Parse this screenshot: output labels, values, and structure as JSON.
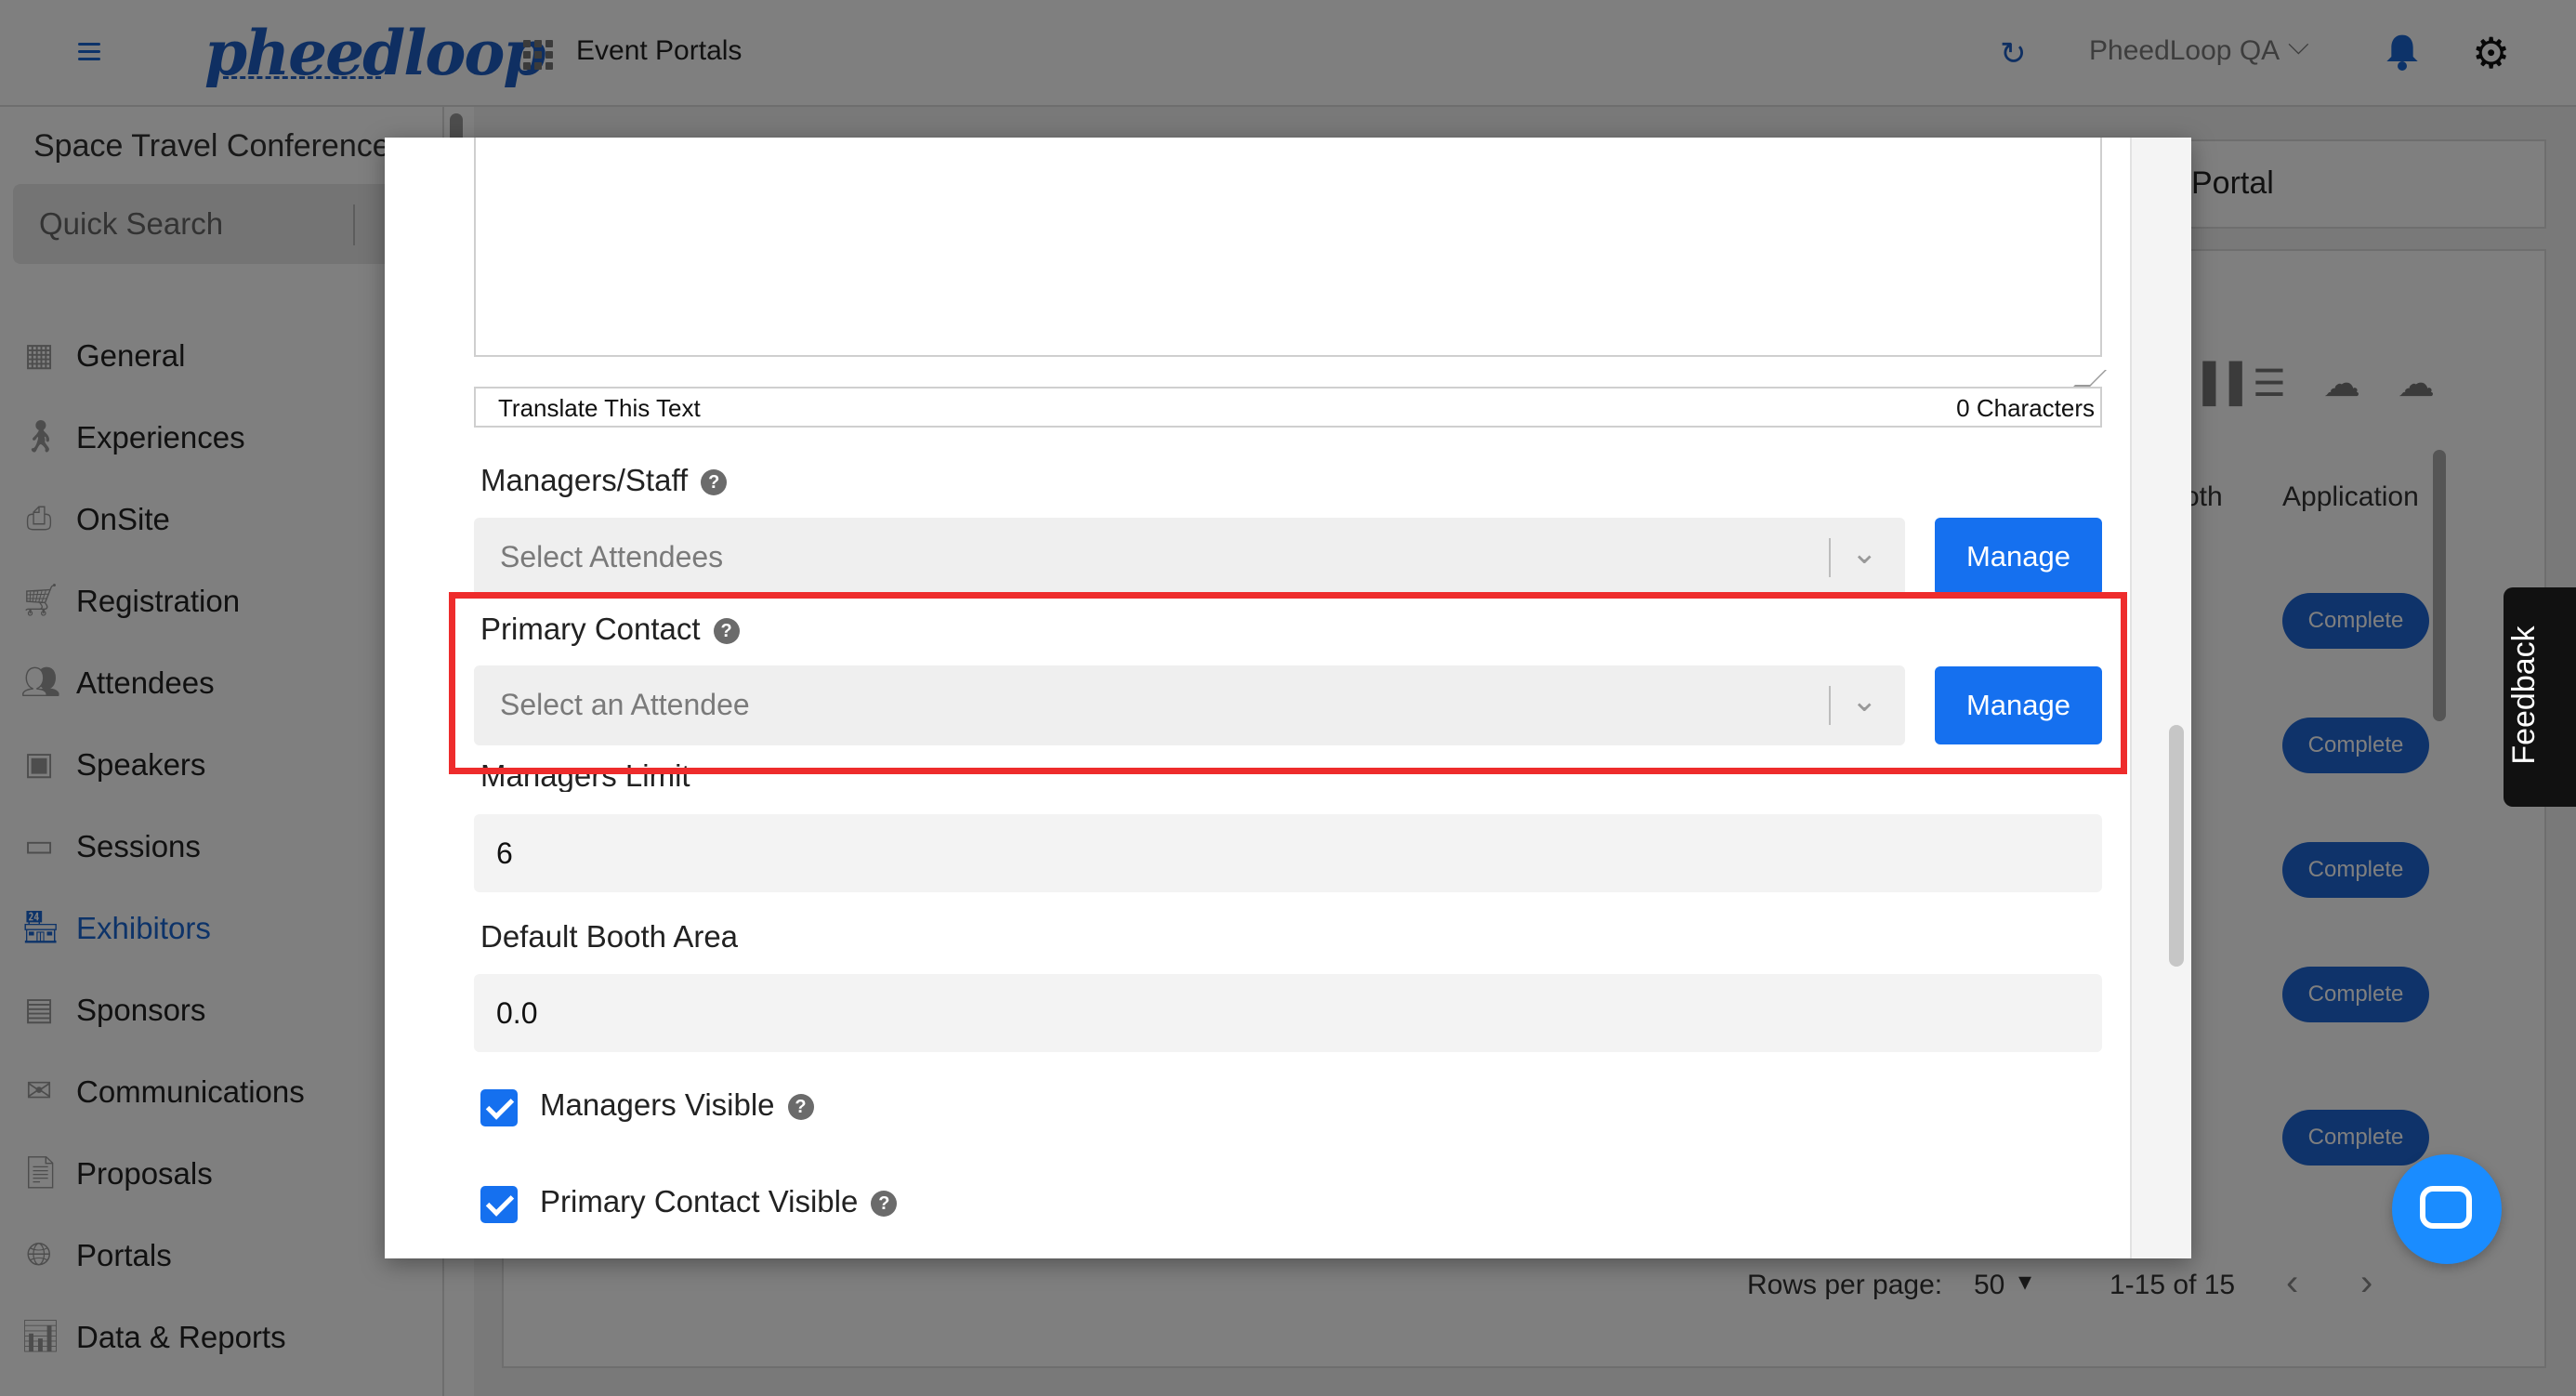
{
  "topbar": {
    "logo": "pheedloop",
    "title": "Event Portals",
    "org_name": "PheedLoop QA"
  },
  "sidebar": {
    "event_name": "Space Travel Conference",
    "quick_search": "Quick Search",
    "items": [
      {
        "label": "General",
        "icon": "grid-icon"
      },
      {
        "label": "Experiences",
        "icon": "person-icon"
      },
      {
        "label": "OnSite",
        "icon": "printer-icon"
      },
      {
        "label": "Registration",
        "icon": "cart-icon"
      },
      {
        "label": "Attendees",
        "icon": "people-icon"
      },
      {
        "label": "Speakers",
        "icon": "presenter-icon"
      },
      {
        "label": "Sessions",
        "icon": "laptop-icon"
      },
      {
        "label": "Exhibitors",
        "icon": "store-icon"
      },
      {
        "label": "Sponsors",
        "icon": "badge-icon"
      },
      {
        "label": "Communications",
        "icon": "mail-icon"
      },
      {
        "label": "Proposals",
        "icon": "document-icon"
      },
      {
        "label": "Portals",
        "icon": "globe-icon"
      },
      {
        "label": "Data & Reports",
        "icon": "chart-icon"
      }
    ],
    "active_item": "Exhibitors"
  },
  "background": {
    "portal_card": "Portal",
    "columns": [
      "oth",
      "Application"
    ],
    "status_buttons": [
      "Complete",
      "Complete",
      "Complete",
      "Complete",
      "Complete"
    ],
    "rows_per_page_label": "Rows per page:",
    "rows_per_page_value": "50",
    "page_range": "1-15 of 15"
  },
  "feedback_label": "Feedback",
  "modal": {
    "translate_label": "Translate This Text",
    "char_count": "0 Characters",
    "managers_label": "Managers/Staff",
    "managers_placeholder": "Select Attendees",
    "manage_label": "Manage",
    "primary_contact_label": "Primary Contact",
    "primary_contact_placeholder": "Select an Attendee",
    "managers_limit_label": "Managers Limit",
    "managers_limit_value": "6",
    "booth_area_label": "Default Booth Area",
    "booth_area_value": "0.0",
    "managers_visible_label": "Managers Visible",
    "primary_contact_visible_label": "Primary Contact Visible",
    "help_symbol": "?"
  },
  "colors": {
    "accent": "#1570ef",
    "highlight": "#ee2c2c",
    "active_nav": "#1a67d2"
  }
}
